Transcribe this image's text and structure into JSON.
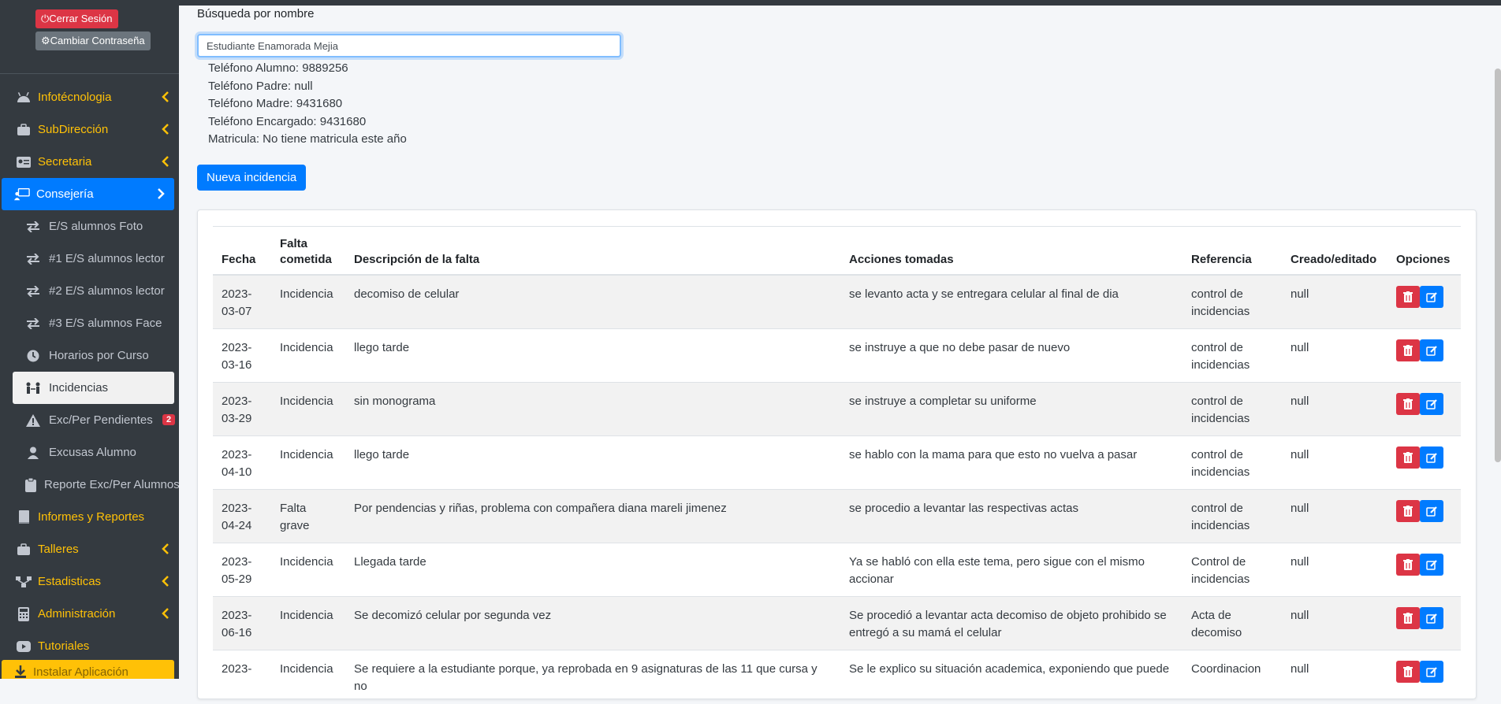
{
  "user": {
    "logout_label": "Cerrar Sesión",
    "change_password_label": "Cambiar Contraseña"
  },
  "sidebar": {
    "items": [
      {
        "label": "Infotécnologia",
        "icon": "android-icon"
      },
      {
        "label": "SubDirección",
        "icon": "briefcase-icon"
      },
      {
        "label": "Secretaria",
        "icon": "id-card-icon"
      },
      {
        "label": "Consejería",
        "icon": "chalkboard-teacher-icon"
      }
    ],
    "subitems": [
      {
        "label": "E/S alumnos Foto",
        "icon": "exchange-icon"
      },
      {
        "label": "#1 E/S alumnos lector",
        "icon": "exchange-icon"
      },
      {
        "label": "#2 E/S alumnos lector",
        "icon": "exchange-icon"
      },
      {
        "label": "#3 E/S alumnos Face",
        "icon": "exchange-icon"
      },
      {
        "label": "Horarios por Curso",
        "icon": "clock-icon"
      },
      {
        "label": "Incidencias",
        "icon": "people-arrows-icon"
      },
      {
        "label": "Exc/Per Pendientes",
        "icon": "warning-icon",
        "badge": "2"
      },
      {
        "label": "Excusas Alumno",
        "icon": "user-icon"
      },
      {
        "label": "Reporte Exc/Per Alumnos",
        "icon": "clipboard-icon"
      }
    ],
    "items2": [
      {
        "label": "Informes y Reportes",
        "icon": "book-icon"
      },
      {
        "label": "Talleres",
        "icon": "briefcase-icon"
      },
      {
        "label": "Estadisticas",
        "icon": "sitemap-icon"
      },
      {
        "label": "Administración",
        "icon": "calculator-icon"
      },
      {
        "label": "Tutoriales",
        "icon": "youtube-icon"
      }
    ],
    "install_label": "Instalar Aplicación"
  },
  "search": {
    "label": "Búsqueda por nombre",
    "value": "Estudiante Enamorada Mejia"
  },
  "student": {
    "phone_student": "Teléfono Alumno: 9889256",
    "phone_father": "Teléfono Padre: null",
    "phone_mother": "Teléfono Madre: 9431680",
    "phone_guardian": "Teléfono Encargado: 9431680",
    "enrollment": "Matricula: No tiene matricula este año"
  },
  "new_incident_label": "Nueva incidencia",
  "table": {
    "headers": [
      "Fecha",
      "Falta cometida",
      "Descripción de la falta",
      "Acciones tomadas",
      "Referencia",
      "Creado/editado",
      "Opciones"
    ],
    "rows": [
      {
        "date": "2023-03-07",
        "type": "Incidencia",
        "desc": "decomiso de celular",
        "action": "se levanto acta y se entregara celular al final de dia",
        "ref": "control de incidencias",
        "by": "null"
      },
      {
        "date": "2023-03-16",
        "type": "Incidencia",
        "desc": "llego tarde",
        "action": "se instruye a que no debe pasar de nuevo",
        "ref": "control de incidencias",
        "by": "null"
      },
      {
        "date": "2023-03-29",
        "type": "Incidencia",
        "desc": "sin monograma",
        "action": "se instruye a completar su uniforme",
        "ref": "control de incidencias",
        "by": "null"
      },
      {
        "date": "2023-04-10",
        "type": "Incidencia",
        "desc": "llego tarde",
        "action": "se hablo con la mama para que esto no vuelva a pasar",
        "ref": "control de incidencias",
        "by": "null"
      },
      {
        "date": "2023-04-24",
        "type": "Falta grave",
        "desc": "Por pendencias y riñas, problema con compañera diana mareli jimenez",
        "action": "se procedio a levantar las respectivas actas",
        "ref": "control de incidencias",
        "by": "null"
      },
      {
        "date": "2023-05-29",
        "type": "Incidencia",
        "desc": "Llegada tarde",
        "action": "Ya se habló con ella este tema, pero sigue con el mismo accionar",
        "ref": "Control de incidencias",
        "by": "null"
      },
      {
        "date": "2023-06-16",
        "type": "Incidencia",
        "desc": "Se decomizó celular por segunda vez",
        "action": "Se procedió a levantar acta decomiso de objeto prohibido se entregó a su mamá el celular",
        "ref": "Acta de decomiso",
        "by": "null"
      },
      {
        "date": "2023-",
        "type": "Incidencia",
        "desc": "Se requiere a la estudiante porque, ya reprobada en 9 asignaturas de las 11 que cursa y no",
        "action": "Se le explico su situación academica, exponiendo que puede",
        "ref": "Coordinacion",
        "by": "null"
      }
    ]
  },
  "colors": {
    "sidebar_bg": "#343a40",
    "accent": "#007bff",
    "danger": "#dc3545",
    "menu_text": "#ffc107"
  }
}
